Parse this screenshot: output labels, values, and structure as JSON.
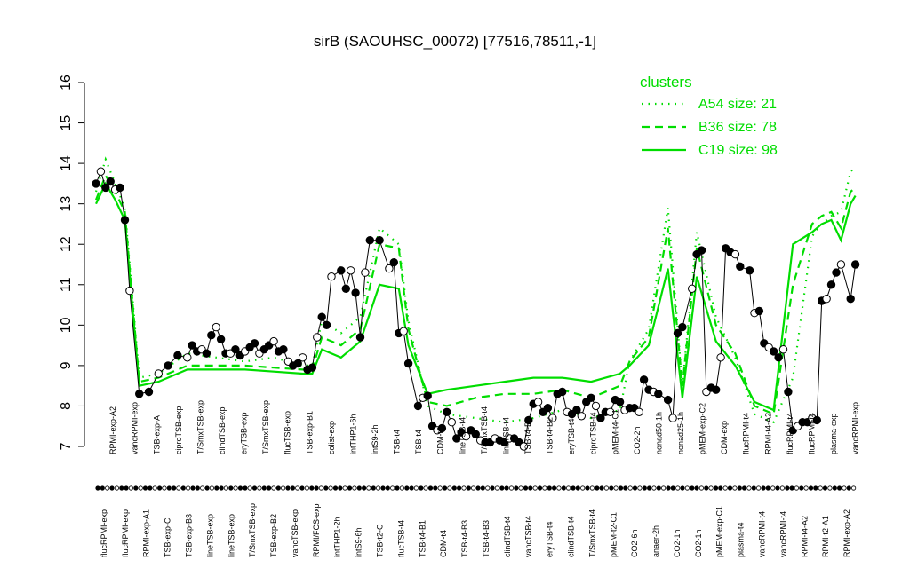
{
  "chart_data": {
    "type": "line",
    "title": "sirB (SAOUHSC_00072) [77516,78511,-1]",
    "xlabel": "",
    "ylabel": "",
    "ylim": [
      7,
      16
    ],
    "yticks": [
      7,
      8,
      9,
      10,
      11,
      12,
      13,
      14,
      15,
      16
    ],
    "xlim": [
      1,
      160
    ],
    "grid": false,
    "legend": {
      "title": "clusters",
      "placement": "top-right",
      "entries": [
        {
          "label": "A54 size: 21",
          "style": "dotted"
        },
        {
          "label": "B36 size: 78",
          "style": "dashed"
        },
        {
          "label": "C19 size: 98",
          "style": "solid"
        }
      ]
    },
    "colors": {
      "cluster_lines": "#00dd00",
      "points": "#000000",
      "axis": "#000000"
    },
    "bottom_labels": [
      "flucRPMI-exp",
      "flucRPMI-exp",
      "RPMI-exp-A1",
      "TSB-exp-C",
      "TSB-exp-B3",
      "lineTSB-exp",
      "lineTSB-exp",
      "T/SmxTSB-exp",
      "TSB-exp-B2",
      "vancTSB-exp",
      "RPMI/FCS-exp",
      "intTHP1-2h",
      "intS9-6h",
      "TSB-t2-C",
      "flucTSB-t4",
      "TSB-t4-B1",
      "CDM-t4",
      "TSB-t4-B3",
      "TSB-t4-B3",
      "clindTSB-t4",
      "vancTSB-t4",
      "eryTSB-t4",
      "clindTSB-t4",
      "T/SmxTSB-t4",
      "pMEM-t2-C1",
      "CO2-6h",
      "anaer-2h",
      "CO2-1h",
      "CO2-1h",
      "pMEM-exp-C1",
      "plasma-t4",
      "vancRPMI-t4",
      "vancRPMI-t4",
      "RPMI-t4-A2",
      "RPMI-t2-A1",
      "RPMI-exp-A2"
    ],
    "upper_labels": [
      "RPMI-exp-A2",
      "vancRPMI-exp",
      "TSB-exp-A",
      "ciproTSB-exp",
      "T/SmxTSB-exp",
      "clindTSB-exp",
      "eryTSB-exp",
      "T/SmxTSB-exp",
      "flucTSB-exp",
      "TSB-exp-B1",
      "colist-exp",
      "intTHP1-6h",
      "intS9-2h",
      "TSB-t4",
      "TSB-t4",
      "CDM-t2",
      "lineTSB-t4",
      "T/SmxTSB-t4",
      "lineTSB-t4",
      "TSB-t4-B2",
      "TSB-t4-B2",
      "eryTSB-t4",
      "ciproTSB-t4",
      "pMEM-t4-C1",
      "CO2-2h",
      "nonad50-1h",
      "nonad25-1h",
      "pMEM-exp-C2",
      "CDM-exp",
      "flucRPMI-t4",
      "RPMI-t4-A2",
      "flucRPMI-t4",
      "flucRPMI-t4",
      "plasma-exp",
      "vancRPMI-exp"
    ],
    "points": {
      "x": [
        1,
        2,
        3,
        4,
        5,
        6,
        7,
        8,
        10,
        12,
        14,
        16,
        18,
        20,
        21,
        22,
        23,
        24,
        25,
        26,
        27,
        28,
        29,
        30,
        31,
        32,
        33,
        34,
        35,
        36,
        37,
        38,
        39,
        40,
        41,
        42,
        43,
        44,
        45,
        46,
        47,
        48,
        49,
        50,
        52,
        53,
        54,
        55,
        56,
        57,
        58,
        60,
        62,
        63,
        64,
        65,
        66,
        68,
        69,
        70,
        71,
        72,
        73,
        74,
        75,
        76,
        77,
        78,
        79,
        80,
        81,
        82,
        83,
        84,
        85,
        86,
        87,
        88,
        89,
        90,
        91,
        92,
        93,
        94,
        95,
        96,
        97,
        98,
        99,
        100,
        101,
        102,
        103,
        104,
        105,
        106,
        107,
        108,
        109,
        110,
        111,
        112,
        113,
        114,
        115,
        116,
        117,
        118,
        120,
        121,
        122,
        123,
        125,
        126,
        127,
        128,
        129,
        130,
        131,
        132,
        133,
        134,
        135,
        137,
        138,
        139,
        140,
        141,
        142,
        143,
        144,
        145,
        146,
        147,
        148,
        149,
        150,
        151,
        152,
        153,
        154,
        155,
        156,
        158,
        159
      ],
      "y": [
        13.5,
        13.8,
        13.4,
        13.55,
        13.35,
        13.4,
        12.6,
        10.85,
        8.3,
        8.35,
        8.8,
        9.0,
        9.25,
        9.2,
        9.5,
        9.35,
        9.4,
        9.3,
        9.75,
        9.95,
        9.65,
        9.3,
        9.3,
        9.4,
        9.25,
        9.35,
        9.45,
        9.55,
        9.3,
        9.4,
        9.5,
        9.6,
        9.35,
        9.4,
        9.1,
        9.0,
        9.05,
        9.2,
        8.9,
        8.95,
        9.7,
        10.2,
        10.0,
        11.2,
        11.35,
        10.9,
        11.35,
        10.8,
        9.7,
        11.3,
        12.1,
        12.1,
        11.4,
        11.55,
        9.8,
        9.85,
        9.05,
        8.0,
        8.2,
        8.25,
        7.5,
        7.4,
        7.45,
        7.85,
        7.6,
        7.2,
        7.35,
        7.25,
        7.4,
        7.3,
        7.15,
        7.1,
        7.1,
        7.2,
        7.15,
        7.1,
        7.2,
        7.2,
        7.1,
        7.0,
        7.65,
        8.05,
        8.1,
        7.85,
        7.95,
        7.7,
        8.3,
        8.35,
        7.85,
        7.8,
        7.9,
        7.75,
        8.1,
        8.2,
        8.0,
        7.7,
        7.85,
        7.85,
        8.15,
        8.1,
        7.9,
        7.95,
        7.95,
        7.85,
        8.65,
        8.4,
        8.35,
        8.3,
        8.15,
        7.7,
        9.8,
        9.95,
        10.9,
        11.75,
        11.85,
        8.35,
        8.45,
        8.4,
        9.2,
        11.9,
        11.8,
        11.75,
        11.45,
        11.35,
        10.3,
        10.35,
        9.55,
        9.45,
        9.35,
        9.2,
        9.4,
        8.35,
        7.4,
        7.5,
        7.6,
        7.6,
        7.7,
        7.65,
        10.6,
        10.65,
        11.0,
        11.3,
        11.5,
        10.65,
        11.5,
        12.0,
        13.0,
        12.4,
        12.95,
        13.05,
        13.6,
        13.5
      ]
    },
    "series": [
      {
        "name": "A54 size: 21",
        "style": "dotted",
        "x": [
          1,
          3,
          5,
          7,
          10,
          14,
          20,
          26,
          32,
          38,
          44,
          46,
          48,
          52,
          56,
          60,
          64,
          66,
          70,
          74,
          80,
          86,
          92,
          98,
          104,
          110,
          112,
          116,
          120,
          123,
          126,
          130,
          134,
          138,
          142,
          146,
          150,
          152,
          154,
          156,
          158,
          159
        ],
        "y": [
          13.3,
          14.1,
          13.5,
          12.9,
          8.7,
          8.8,
          9.3,
          9.2,
          9.1,
          9.2,
          9.0,
          9.0,
          10.1,
          9.8,
          10.2,
          12.4,
          12.0,
          10.1,
          8.0,
          7.8,
          7.7,
          7.6,
          7.7,
          7.9,
          7.7,
          7.9,
          9.1,
          9.9,
          12.9,
          8.5,
          12.3,
          10.2,
          9.2,
          7.8,
          7.6,
          8.7,
          12.2,
          12.5,
          12.7,
          12.8,
          13.8,
          13.9
        ]
      },
      {
        "name": "B36 size: 78",
        "style": "dashed",
        "x": [
          1,
          3,
          5,
          7,
          10,
          14,
          20,
          26,
          32,
          38,
          44,
          46,
          48,
          52,
          56,
          60,
          64,
          66,
          70,
          74,
          80,
          86,
          92,
          98,
          104,
          110,
          112,
          116,
          120,
          123,
          126,
          130,
          134,
          138,
          142,
          146,
          150,
          152,
          154,
          156,
          158,
          159
        ],
        "y": [
          13.1,
          13.7,
          13.3,
          12.8,
          8.6,
          8.7,
          9.0,
          9.0,
          9.0,
          8.95,
          8.9,
          8.9,
          9.7,
          9.5,
          9.9,
          12.0,
          11.9,
          9.9,
          8.1,
          8.0,
          8.2,
          8.3,
          8.3,
          8.4,
          8.2,
          8.5,
          9.1,
          9.7,
          12.4,
          8.5,
          11.9,
          10.0,
          9.3,
          8.0,
          7.8,
          11.0,
          12.5,
          12.7,
          12.8,
          12.4,
          13.3,
          13.4
        ]
      },
      {
        "name": "C19 size: 98",
        "style": "solid",
        "x": [
          1,
          3,
          5,
          7,
          10,
          14,
          20,
          26,
          32,
          38,
          44,
          46,
          48,
          52,
          56,
          60,
          64,
          66,
          70,
          74,
          80,
          86,
          92,
          98,
          104,
          110,
          112,
          116,
          120,
          123,
          126,
          130,
          134,
          138,
          142,
          146,
          150,
          152,
          154,
          156,
          158,
          159
        ],
        "y": [
          13.0,
          13.5,
          13.1,
          12.6,
          8.5,
          8.6,
          8.9,
          8.9,
          8.9,
          8.85,
          8.8,
          8.8,
          9.4,
          9.2,
          9.6,
          11.0,
          10.9,
          9.5,
          8.3,
          8.4,
          8.5,
          8.6,
          8.7,
          8.7,
          8.6,
          8.8,
          9.0,
          9.5,
          11.4,
          8.2,
          11.2,
          9.6,
          9.0,
          8.1,
          7.9,
          12.0,
          12.3,
          12.5,
          12.6,
          12.1,
          13.0,
          13.2
        ]
      }
    ]
  }
}
